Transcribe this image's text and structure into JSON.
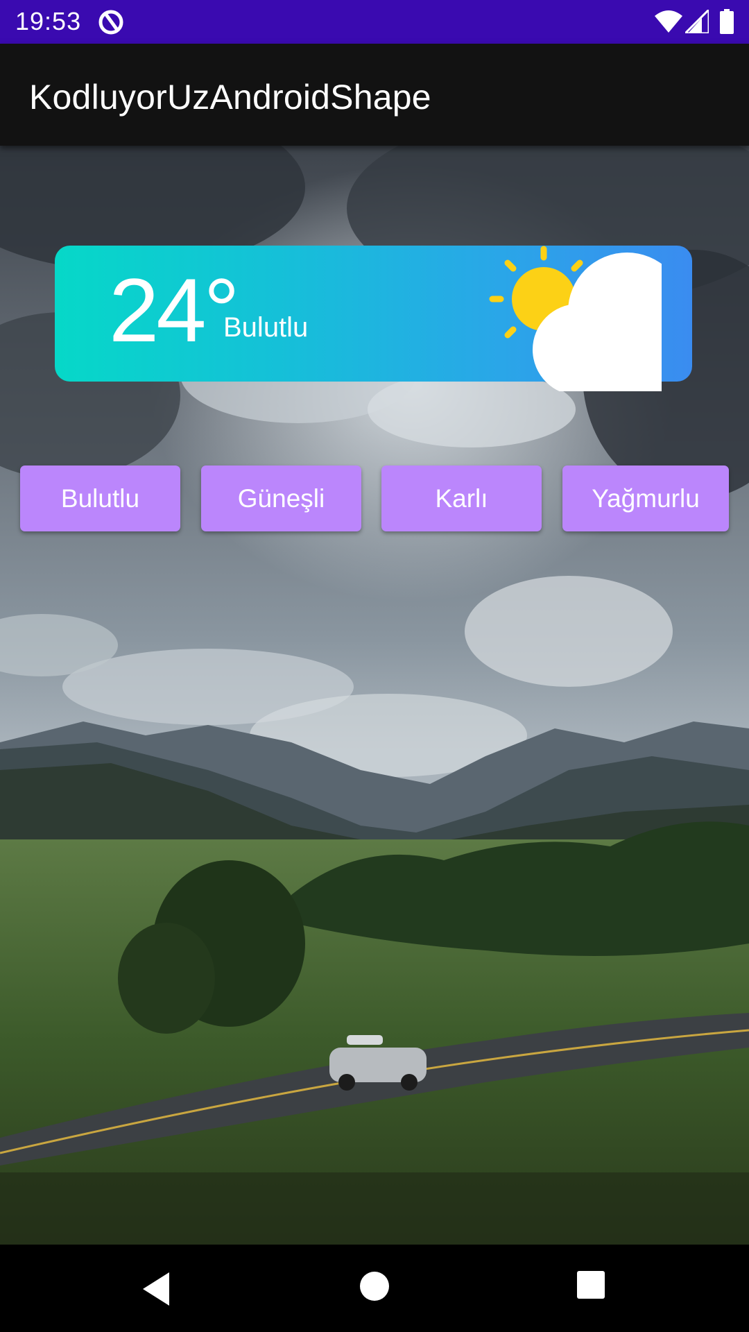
{
  "status_bar": {
    "time": "19:53",
    "icons": [
      "notification-icon",
      "wifi-icon",
      "signal-icon",
      "battery-icon"
    ]
  },
  "app_bar": {
    "title": "KodluyorUzAndroidShape"
  },
  "weather_card": {
    "temperature": "24°",
    "condition": "Bulutlu",
    "icon": "partly-cloudy-icon",
    "gradient": [
      "#06d8c8",
      "#3a8cf0"
    ]
  },
  "buttons": [
    {
      "label": "Bulutlu"
    },
    {
      "label": "Güneşli"
    },
    {
      "label": "Karlı"
    },
    {
      "label": "Yağmurlu"
    }
  ],
  "colors": {
    "status_bar": "#3a0ab0",
    "app_bar": "#121212",
    "button": "#bb86fc"
  },
  "nav_bar": {
    "icons": [
      "back-icon",
      "home-icon",
      "recents-icon"
    ]
  }
}
